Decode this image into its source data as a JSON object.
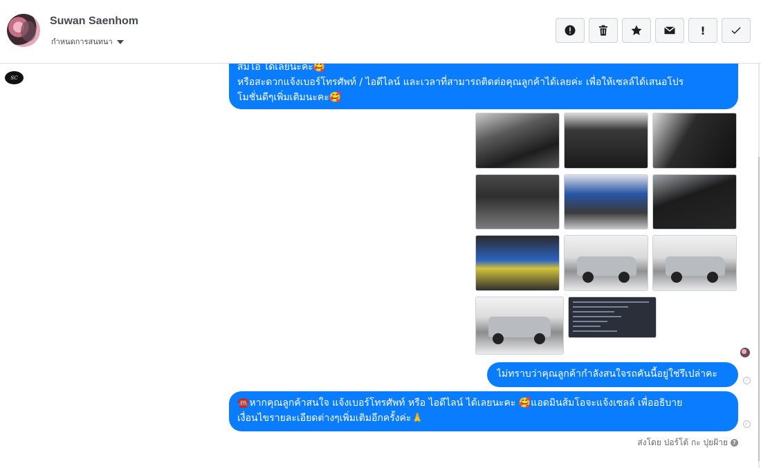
{
  "header": {
    "user_name": "Suwan Saenhom",
    "status_select": "กำหนดการสนทนา",
    "toolbar": [
      {
        "name": "spam-button",
        "icon": "alert-circle-icon"
      },
      {
        "name": "delete-button",
        "icon": "trash-icon"
      },
      {
        "name": "star-button",
        "icon": "star-icon"
      },
      {
        "name": "mark-unread-button",
        "icon": "envelope-icon"
      },
      {
        "name": "follow-up-button",
        "icon": "exclamation-icon",
        "glyph": "!"
      },
      {
        "name": "mark-done-button",
        "icon": "check-icon"
      }
    ]
  },
  "conversation": {
    "page_avatar_text": "SC",
    "messages": [
      {
        "id": "msg-1",
        "lines": [
          "ส้มโอ ได้เลยนะคะ🥰",
          "หรือสะดวกแจ้งเบอร์โทรศัพท์ / ไอดีไลน์ และเวลาที่สามารถติดต่อคุณลูกค้าได้เลยค่ะ เพื่อให้เซลล์ได้เสนอโปร",
          "โมชั่นดีๆเพิ่มเติมนะคะ🥰"
        ]
      },
      {
        "id": "msg-2",
        "lines": [
          "ไม่ทราบว่าคุณลูกค้ากำลังสนใจรถคันนี้อยู่ใช่รึเปล่าคะ"
        ]
      },
      {
        "id": "msg-3",
        "lines": [
          "☎️หากคุณลูกค้าสนใจ แจ้งเบอร์โทรศัพท์ หรือ ไอดีไลน์  ได้เลยนะคะ 🥰แอดมินส้มโอจะแจ้งเซลล์   เพื่ออธิบาย",
          "เงื่อนไขรายละเอียดต่างๆเพิ่มเติมอีกครั้งค่ะ🙏"
        ]
      }
    ],
    "photos": [
      {
        "subject": "interior-dashboard"
      },
      {
        "subject": "gear-console"
      },
      {
        "subject": "front-seats"
      },
      {
        "subject": "center-console"
      },
      {
        "subject": "engine-bay"
      },
      {
        "subject": "rear-seat"
      },
      {
        "subject": "battery"
      },
      {
        "subject": "truck-front-view"
      },
      {
        "subject": "truck-front-view-2"
      },
      {
        "subject": "truck-rear-view"
      },
      {
        "subject": "document-screenshot"
      }
    ],
    "sent_by": "ส่งโดย ปอร์โต้ กะ ปุยฝ้าย",
    "help_glyph": "?"
  },
  "colors": {
    "bubble": "#0a7cff",
    "muted_text": "#65676b",
    "header_border": "#dddfe2"
  }
}
